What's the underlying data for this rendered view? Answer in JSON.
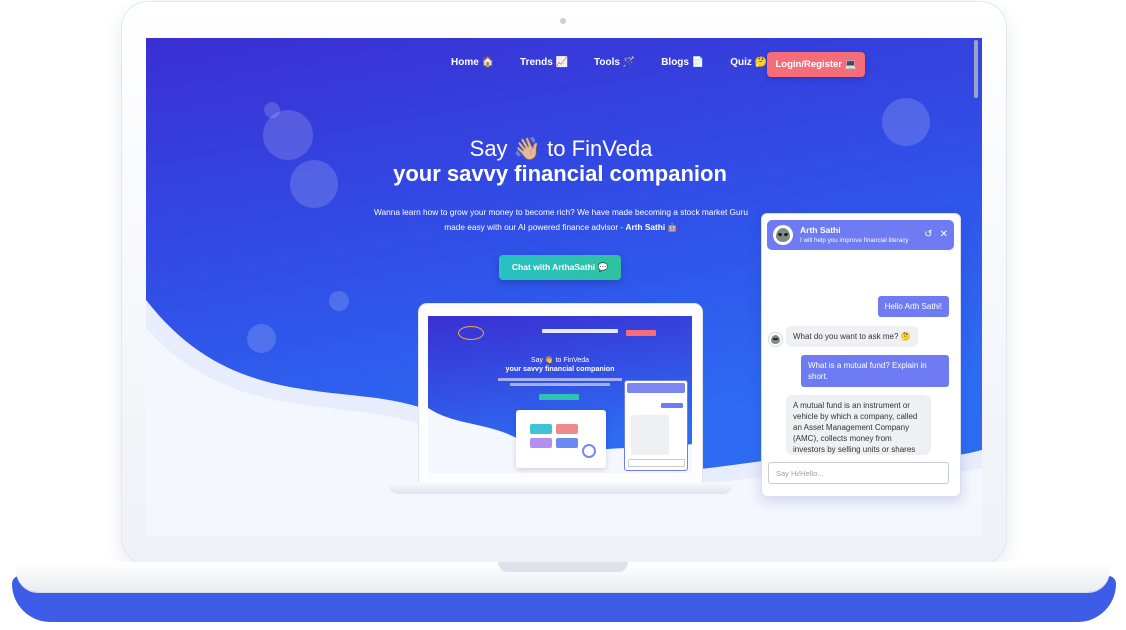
{
  "nav": {
    "items": [
      {
        "label": "Home 🏠"
      },
      {
        "label": "Trends 📈"
      },
      {
        "label": "Tools 🪄"
      },
      {
        "label": "Blogs 📄"
      },
      {
        "label": "Quiz 🤔"
      }
    ],
    "login_label": "Login/Register 💻"
  },
  "hero": {
    "line1": "Say 👋🏼 to FinVeda",
    "line2": "your savvy financial companion",
    "paragraph_line1": "Wanna learn how to grow your money to become rich? We have made becoming a stock market Guru",
    "paragraph_line2": "made easy with our AI powered finance advisor - ",
    "advisor_name": "Arth Sathi 🤖",
    "cta_label": "Chat with ArthaSathi 💬"
  },
  "mini_preview": {
    "line1": "Say 👋 to FinVeda",
    "line2": "your savvy financial companion"
  },
  "chatbot": {
    "name": "Arth Sathi",
    "subtitle": "I will help you improve financial literacy",
    "refresh_icon": "↺",
    "close_icon": "✕",
    "messages": [
      {
        "from": "user",
        "text": "Hello Arth Sathi!"
      },
      {
        "from": "bot",
        "text": "What do you want to ask me? 🤔"
      },
      {
        "from": "user",
        "text": "What is a mutual fund? Explain in short."
      },
      {
        "from": "bot",
        "text": "A mutual fund is an instrument or vehicle by which a company, called an Asset Management Company (AMC), collects money from investors by selling units or shares"
      }
    ],
    "input_placeholder": "Say Hi/Hello..."
  },
  "colors": {
    "hero_gradient_top": "#3a34d6",
    "hero_gradient_bottom": "#2f6cf0",
    "login": "#f66d7a",
    "cta": "#2ec2b0",
    "chat_accent": "#6e7bf2"
  }
}
